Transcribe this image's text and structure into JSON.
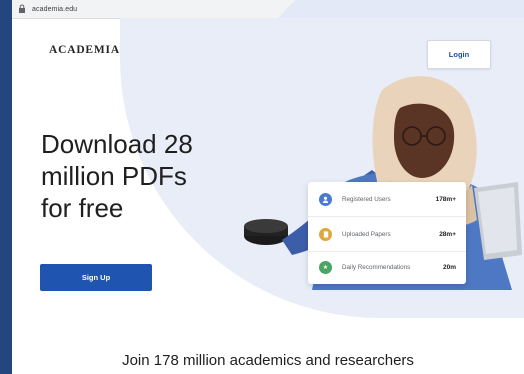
{
  "browser": {
    "url": "academia.edu",
    "icons": [
      "share-icon",
      "star-icon",
      "extension-icon",
      "menu-icon"
    ]
  },
  "header": {
    "logo": "ACADEMIA",
    "login_label": "Login"
  },
  "hero": {
    "headline_lines": [
      "Download 28",
      "million PDFs",
      "for free"
    ],
    "signup_label": "Sign Up"
  },
  "stats": [
    {
      "label": "Registered Users",
      "value": "178m+",
      "icon": "user-icon",
      "color": "#4a7bd0"
    },
    {
      "label": "Uploaded Papers",
      "value": "28m+",
      "icon": "paper-icon",
      "color": "#e0a83a"
    },
    {
      "label": "Daily Recommendations",
      "value": "20m",
      "icon": "star-icon",
      "color": "#4aa564"
    }
  ],
  "footer": {
    "tagline": "Join 178 million academics and researchers"
  },
  "colors": {
    "frame": "#24467e",
    "accent": "#1f54b0"
  }
}
